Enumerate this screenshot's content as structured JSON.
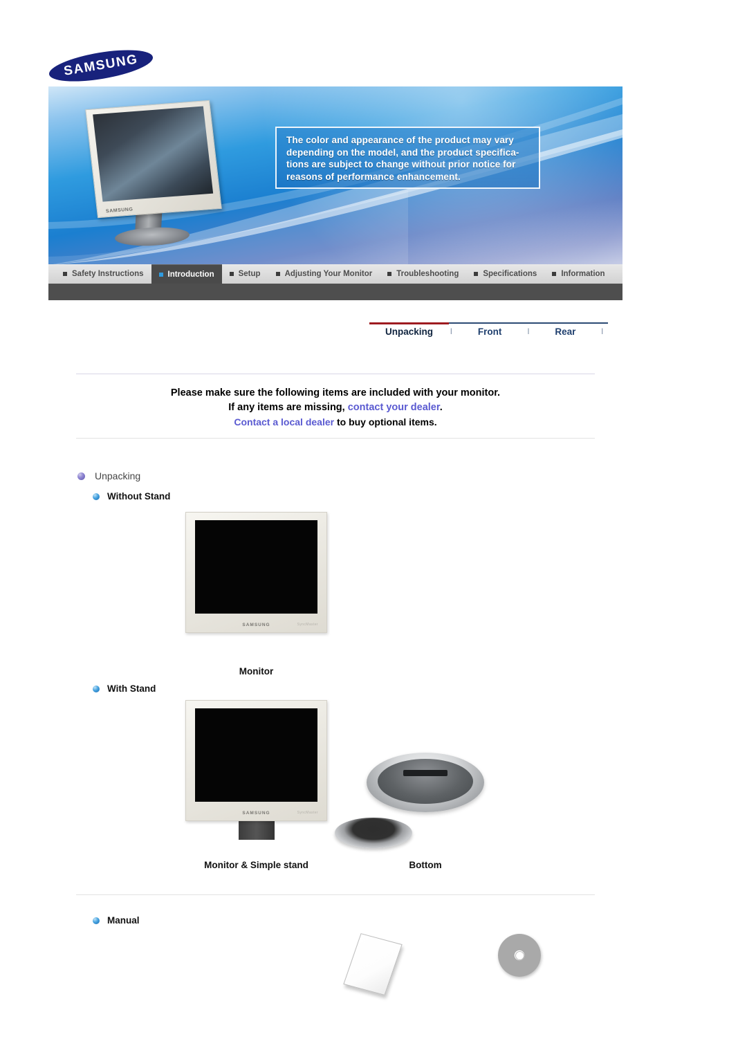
{
  "brand": {
    "logo_text": "SAMSUNG"
  },
  "banner": {
    "notice_lines": [
      "The color and appearance of the product may vary",
      "depending on the model, and the product specifica-",
      "tions are subject to change without prior notice for",
      "reasons of performance enhancement."
    ],
    "monitor_brand_label": "SAMSUNG"
  },
  "mainnav": {
    "items": [
      {
        "label": "Safety Instructions",
        "active": false
      },
      {
        "label": "Introduction",
        "active": true
      },
      {
        "label": "Setup",
        "active": false
      },
      {
        "label": "Adjusting Your Monitor",
        "active": false
      },
      {
        "label": "Troubleshooting",
        "active": false
      },
      {
        "label": "Specifications",
        "active": false
      },
      {
        "label": "Information",
        "active": false
      }
    ]
  },
  "subnav": {
    "items": [
      {
        "label": "Unpacking",
        "current": true
      },
      {
        "label": "Front",
        "current": false
      },
      {
        "label": "Rear",
        "current": false
      }
    ],
    "separator": "l",
    "active_color": "#9e1b20",
    "rule_color": "#2c4a74"
  },
  "intro": {
    "line1": "Please make sure the following items are included with your monitor.",
    "line2_pre": "If any items are missing, ",
    "line2_link": "contact your dealer",
    "line2_post": ".",
    "line3_link": "Contact a local dealer",
    "line3_post": " to buy optional items.",
    "link_color": "#5a5ad1"
  },
  "sections": {
    "unpacking_title": "Unpacking",
    "without_stand_title": "Without Stand",
    "with_stand_title": "With Stand",
    "manual_title": "Manual"
  },
  "captions": {
    "monitor": "Monitor",
    "monitor_simple_stand": "Monitor & Simple stand",
    "bottom": "Bottom"
  },
  "figures": {
    "monitor_brand": "SAMSUNG",
    "monitor_model": "SyncMaster"
  }
}
